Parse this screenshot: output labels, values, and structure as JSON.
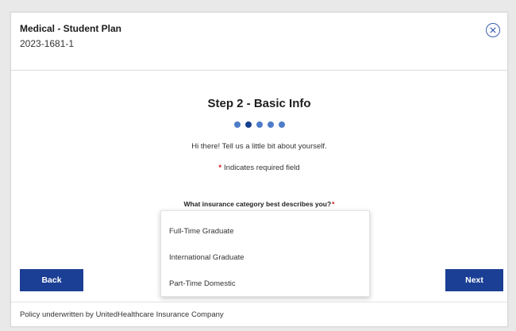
{
  "header": {
    "plan_name": "Medical - Student Plan",
    "plan_id": "2023-1681-1"
  },
  "step": {
    "title": "Step 2 - Basic Info",
    "total_steps": 5,
    "current_step": 2,
    "intro": "Hi there! Tell us a little bit about yourself.",
    "required_star": "*",
    "required_note": "Indicates required field"
  },
  "question": {
    "label": "What insurance category best describes you?",
    "star": "*",
    "options": [
      "Full-Time Graduate",
      "International Graduate",
      "Part-Time Domestic"
    ]
  },
  "nav": {
    "back_label": "Back",
    "next_label": "Next"
  },
  "footer": {
    "text": "Policy underwritten by UnitedHealthcare Insurance Company"
  },
  "colors": {
    "primary": "#1b3f94",
    "dot": "#4d7cc9",
    "dot_active": "#163f8e",
    "required": "#d0131a"
  },
  "icons": {
    "close": "close-circle-icon"
  }
}
